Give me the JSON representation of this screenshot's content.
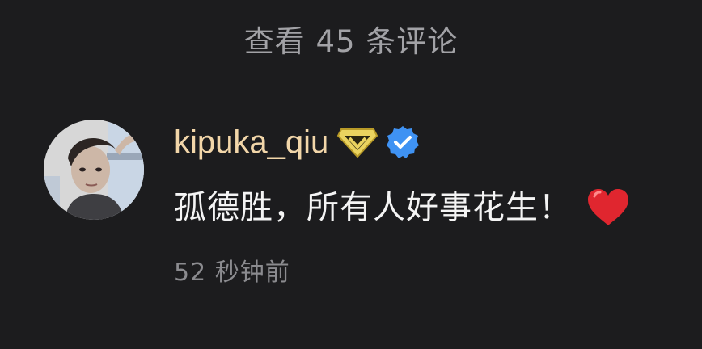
{
  "header": {
    "view_comments_label": "查看 45 条评论"
  },
  "comment": {
    "username": "kipuka_qiu",
    "text": "孤德胜，所有人好事花生！",
    "timestamp": "52 秒钟前",
    "icons": {
      "avatar": "avatar-photo",
      "vip_badge": "vip-diamond-icon",
      "verified_badge": "verified-check-icon",
      "heart": "red-heart-emoji"
    }
  },
  "colors": {
    "background": "#1c1c1e",
    "username": "#f2d6a9",
    "secondary_text": "#a2a2a6",
    "verified_blue": "#3f92f3",
    "vip_gold": "#ead35f",
    "heart_red": "#e0262f"
  }
}
